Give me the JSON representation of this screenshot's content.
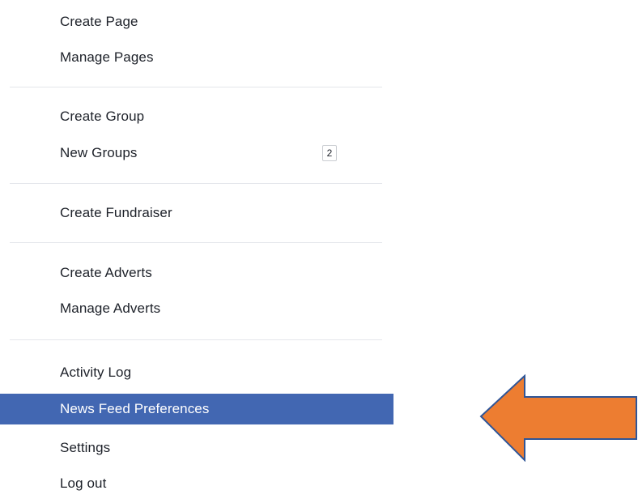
{
  "menu": {
    "items": [
      {
        "label": "Create Page"
      },
      {
        "label": "Manage Pages"
      },
      {
        "label": "Create Group"
      },
      {
        "label": "New Groups",
        "badge": "2"
      },
      {
        "label": "Create Fundraiser"
      },
      {
        "label": "Create Adverts"
      },
      {
        "label": "Manage Adverts"
      },
      {
        "label": "Activity Log"
      },
      {
        "label": "News Feed Preferences",
        "selected": true
      },
      {
        "label": "Settings"
      },
      {
        "label": "Log out"
      }
    ]
  },
  "colors": {
    "selected_background": "#4267b2",
    "arrow_fill": "#ed7d31",
    "arrow_outline": "#2f5597"
  },
  "annotation": {
    "icon": "left-arrow-icon"
  }
}
